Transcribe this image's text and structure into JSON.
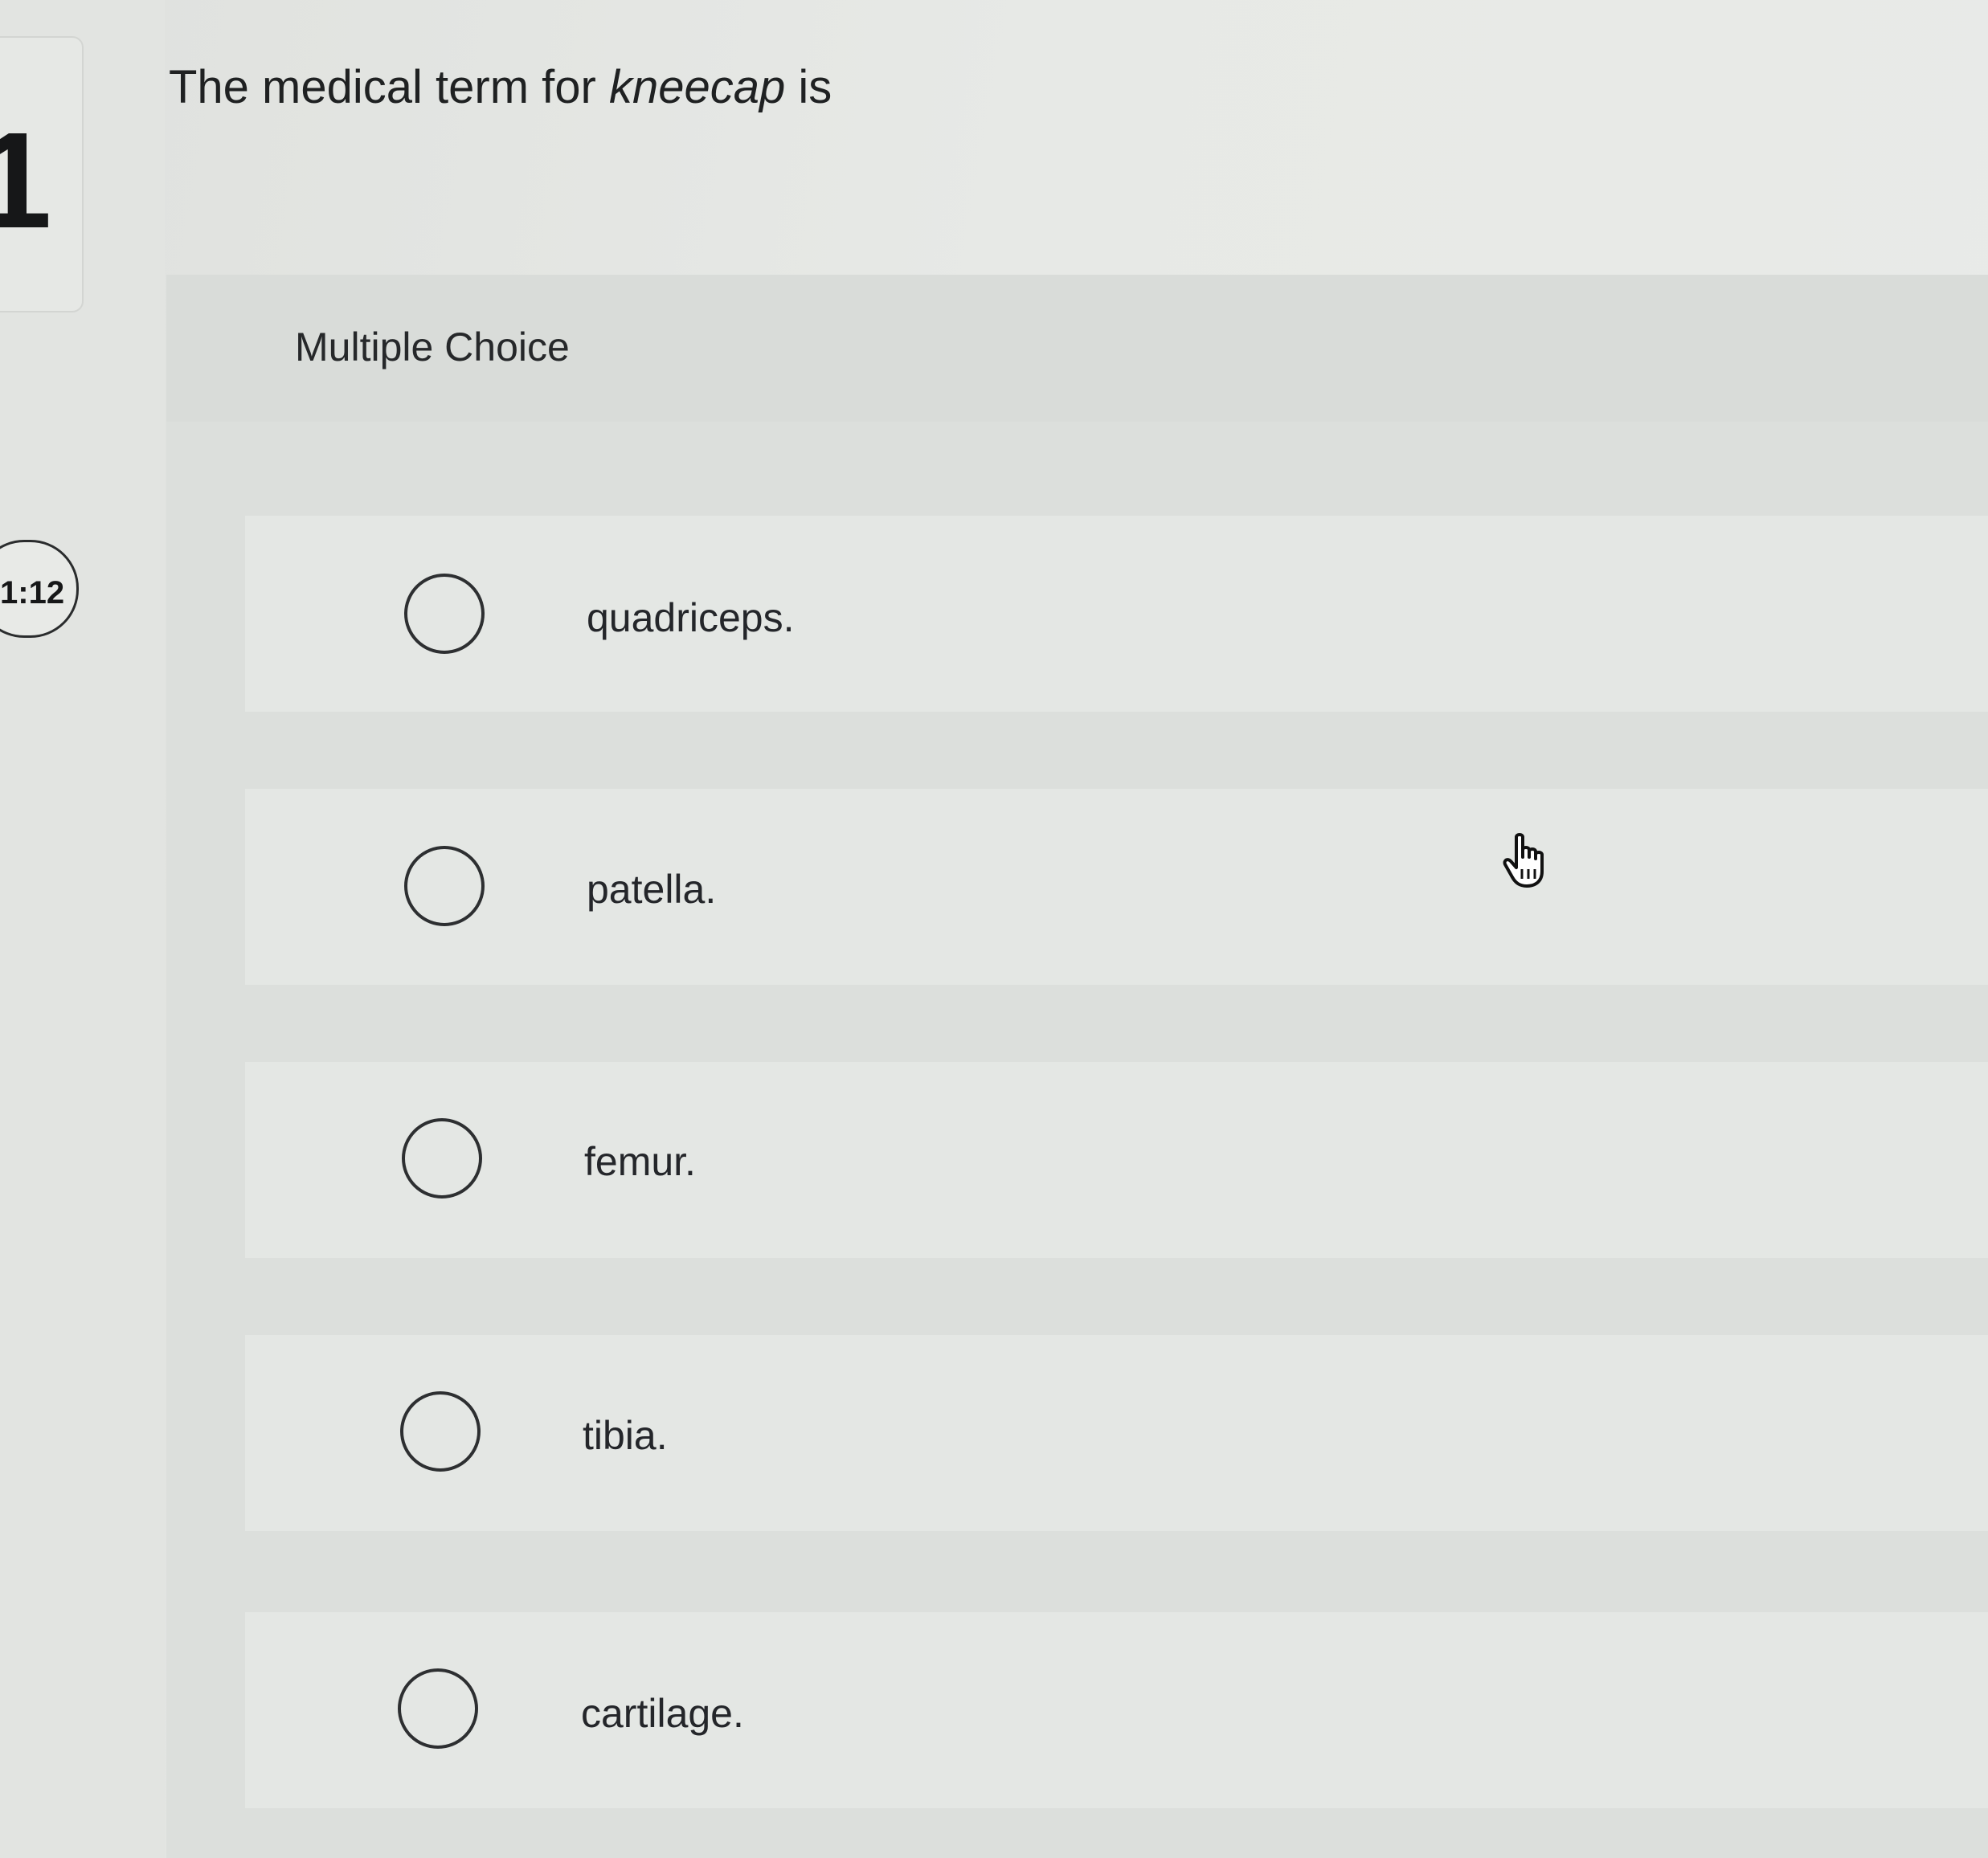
{
  "question": {
    "number": "1",
    "timer": "1:12",
    "prompt_before": "The medical term for ",
    "prompt_term": "kneecap",
    "prompt_after": " is"
  },
  "answer_panel": {
    "title": "Multiple Choice",
    "options": [
      {
        "label": "quadriceps.",
        "selected": false
      },
      {
        "label": "patella.",
        "selected": false
      },
      {
        "label": "femur.",
        "selected": false
      },
      {
        "label": "tibia.",
        "selected": false
      },
      {
        "label": "cartilage.",
        "selected": false
      }
    ]
  },
  "icons": {
    "radio": "radio-button-icon",
    "cursor": "hand-pointer-cursor-icon"
  }
}
